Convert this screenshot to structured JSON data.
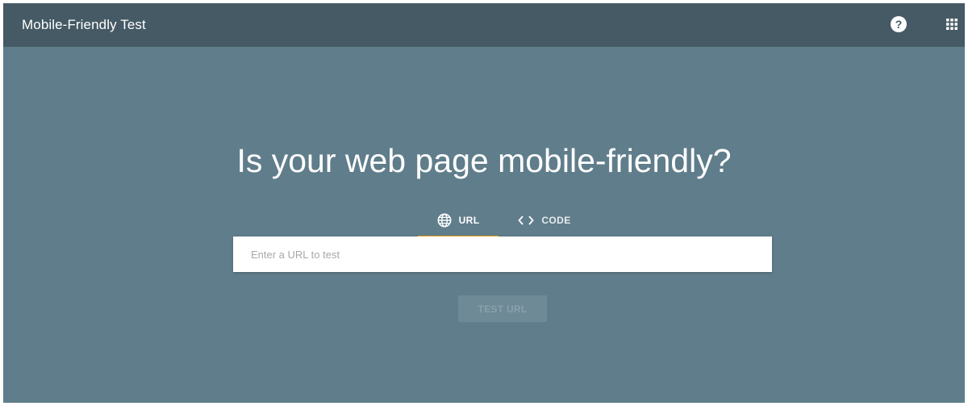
{
  "header": {
    "app_title": "Mobile-Friendly Test",
    "help_icon": "help-circle-icon",
    "help_glyph": "?",
    "apps_icon": "apps-grid-icon"
  },
  "main": {
    "headline": "Is your web page mobile-friendly?",
    "tabs": [
      {
        "label": "URL",
        "icon": "globe-icon",
        "selected": true
      },
      {
        "label": "CODE",
        "icon": "code-brackets-icon",
        "selected": false
      }
    ],
    "url_input": {
      "placeholder": "Enter a URL to test",
      "value": ""
    },
    "test_button": {
      "label": "TEST URL",
      "enabled": false
    }
  },
  "colors": {
    "header_bg": "#455a64",
    "page_bg": "#607d8b",
    "tab_indicator": "#f5a623",
    "text_primary": "#ffffff"
  }
}
